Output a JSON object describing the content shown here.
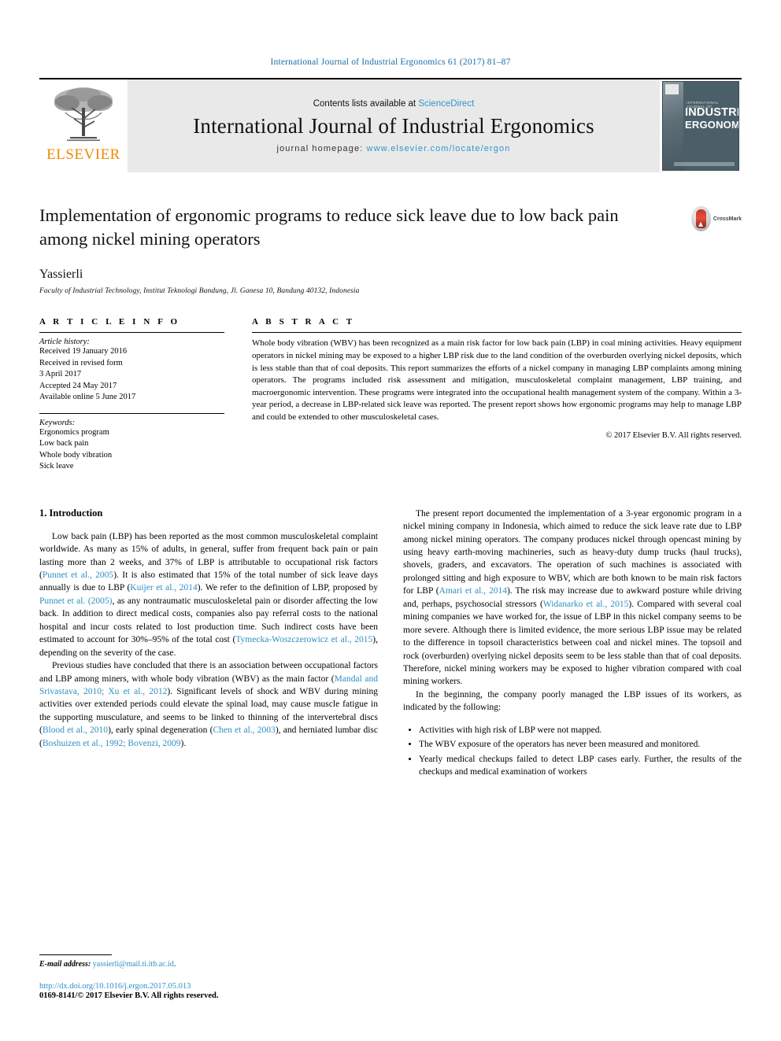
{
  "running_head": "International Journal of Industrial Ergonomics 61 (2017) 81–87",
  "masthead": {
    "publisher_wordmark": "ELSEVIER",
    "contents_prefix": "Contents lists available at ",
    "contents_link": "ScienceDirect",
    "journal_title": "International Journal of Industrial Ergonomics",
    "homepage_prefix": "journal homepage: ",
    "homepage_link": "www.elsevier.com/locate/ergon",
    "cover": {
      "kicker": "INTERNATIONAL JOURNAL OF",
      "line1": "INDUSTRIAL",
      "line2": "ERGONOMICS"
    }
  },
  "article": {
    "title": "Implementation of ergonomic programs to reduce sick leave due to low back pain among nickel mining operators",
    "author": "Yassierli",
    "affiliation": "Faculty of Industrial Technology, Institut Teknologi Bandung, Jl. Ganesa 10, Bandung 40132, Indonesia",
    "crossmark_label": "CrossMark"
  },
  "article_info": {
    "heading": "A R T I C L E   I N F O",
    "history_title": "Article history:",
    "history": [
      "Received 19 January 2016",
      "Received in revised form",
      "3 April 2017",
      "Accepted 24 May 2017",
      "Available online 5 June 2017"
    ],
    "keywords_title": "Keywords:",
    "keywords": [
      "Ergonomics program",
      "Low back pain",
      "Whole body vibration",
      "Sick leave"
    ]
  },
  "abstract": {
    "heading": "A B S T R A C T",
    "text": "Whole body vibration (WBV) has been recognized as a main risk factor for low back pain (LBP) in coal mining activities. Heavy equipment operators in nickel mining may be exposed to a higher LBP risk due to the land condition of the overburden overlying nickel deposits, which is less stable than that of coal deposits. This report summarizes the efforts of a nickel company in managing LBP complaints among mining operators. The programs included risk assessment and mitigation, musculoskeletal complaint management, LBP training, and macroergonomic intervention. These programs were integrated into the occupational health management system of the company. Within a 3-year period, a decrease in LBP-related sick leave was reported. The present report shows how ergonomic programs may help to manage LBP and could be extended to other musculoskeletal cases.",
    "copyright": "© 2017 Elsevier B.V. All rights reserved."
  },
  "body": {
    "section_heading": "1.  Introduction",
    "left_paragraphs": [
      {
        "parts": [
          {
            "t": "Low back pain (LBP) has been reported as the most common musculoskeletal complaint worldwide. As many as 15% of adults, in general, suffer from frequent back pain or pain lasting more than 2 weeks, and 37% of LBP is attributable to occupational risk factors ("
          },
          {
            "t": "Punnet et al., 2005",
            "ref": true
          },
          {
            "t": "). It is also estimated that 15% of the total number of sick leave days annually is due to LBP ("
          },
          {
            "t": "Kuijer et al., 2014",
            "ref": true
          },
          {
            "t": "). We refer to the definition of LBP, proposed by "
          },
          {
            "t": "Punnet et al. (2005)",
            "ref": true
          },
          {
            "t": ", as any nontraumatic musculoskeletal pain or disorder affecting the low back. In addition to direct medical costs, companies also pay referral costs to the national hospital and incur costs related to lost production time. Such indirect costs have been estimated to account for 30%–95% of the total cost ("
          },
          {
            "t": "Tymecka-Woszczerowicz et al., 2015",
            "ref": true
          },
          {
            "t": "), depending on the severity of the case."
          }
        ]
      },
      {
        "parts": [
          {
            "t": "Previous studies have concluded that there is an association between occupational factors and LBP among miners, with whole body vibration (WBV) as the main factor ("
          },
          {
            "t": "Mandal and Srivastava, 2010; Xu et al., 2012",
            "ref": true
          },
          {
            "t": "). Significant levels of shock and WBV during mining activities over extended periods could elevate the spinal load, may cause muscle fatigue in the supporting musculature, and seems to be linked to thinning of the intervertebral discs ("
          },
          {
            "t": "Blood et al., 2010",
            "ref": true
          },
          {
            "t": "), early spinal degeneration ("
          },
          {
            "t": "Chen et al., 2003",
            "ref": true
          },
          {
            "t": "), and herniated lumbar disc ("
          },
          {
            "t": "Boshuizen et al., 1992; Bovenzi, 2009",
            "ref": true
          },
          {
            "t": ")."
          }
        ]
      }
    ],
    "right_paragraphs": [
      {
        "parts": [
          {
            "t": "The present report documented the implementation of a 3-year ergonomic program in a nickel mining company in Indonesia, which aimed to reduce the sick leave rate due to LBP among nickel mining operators. The company produces nickel through opencast mining by using heavy earth-moving machineries, such as heavy-duty dump trucks (haul trucks), shovels, graders, and excavators. The operation of such machines is associated with prolonged sitting and high exposure to WBV, which are both known to be main risk factors for LBP ("
          },
          {
            "t": "Amari et al., 2014",
            "ref": true
          },
          {
            "t": "). The risk may increase due to awkward posture while driving and, perhaps, psychosocial stressors ("
          },
          {
            "t": "Widanarko et al., 2015",
            "ref": true
          },
          {
            "t": "). Compared with several coal mining companies we have worked for, the issue of LBP in this nickel company seems to be more severe. Although there is limited evidence, the more serious LBP issue may be related to the difference in topsoil characteristics between coal and nickel mines. The topsoil and rock (overburden) overlying nickel deposits seem to be less stable than that of coal deposits. Therefore, nickel mining workers may be exposed to higher vibration compared with coal mining workers."
          }
        ]
      },
      {
        "parts": [
          {
            "t": "In the beginning, the company poorly managed the LBP issues of its workers, as indicated by the following:"
          }
        ]
      }
    ],
    "bullets": [
      "Activities with high risk of LBP were not mapped.",
      "The WBV exposure of the operators has never been measured and monitored.",
      "Yearly medical checkups failed to detect LBP cases early. Further, the results of the checkups and medical examination of workers"
    ]
  },
  "footer": {
    "email_label": "E-mail address:",
    "email": "yassierli@mail.ti.itb.ac.id",
    "doi": "http://dx.doi.org/10.1016/j.ergon.2017.05.013",
    "issn_line": "0169-8141/© 2017 Elsevier B.V. All rights reserved."
  },
  "colors": {
    "link": "#2f8fc4",
    "elsevier_orange": "#ED8B00",
    "banner_bg": "#e9e9e9"
  }
}
